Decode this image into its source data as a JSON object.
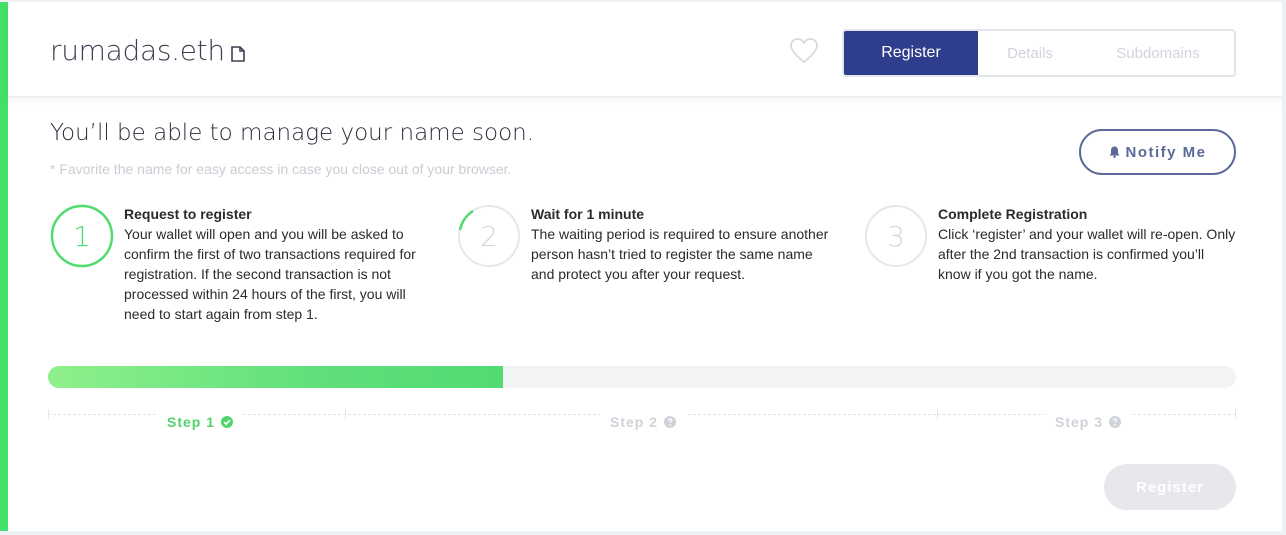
{
  "header": {
    "domain_name": "rumadas.eth",
    "tabs": [
      {
        "label": "Register",
        "active": true
      },
      {
        "label": "Details",
        "active": false
      },
      {
        "label": "Subdomains",
        "active": false
      }
    ]
  },
  "main": {
    "title": "You’ll be able to manage your name soon.",
    "subtitle": "* Favorite the name for easy access in case you close out of your browser.",
    "notify_label": "Notify Me",
    "steps": [
      {
        "number": "1",
        "title": "Request to register",
        "description": "Your wallet will open and you will be asked to confirm the first of two transactions required for registration. If the second transaction is not processed within 24 hours of the first, you will need to start again from step 1."
      },
      {
        "number": "2",
        "title": "Wait for 1 minute",
        "description": "The waiting period is required to ensure another person hasn’t tried to register the same name and protect you after your request."
      },
      {
        "number": "3",
        "title": "Complete Registration",
        "description": "Click ‘register’ and your wallet will re-open. Only after the 2nd transaction is confirmed you’ll know if you got the name."
      }
    ],
    "progress_fraction": 0.383,
    "step_labels": [
      {
        "label": "Step 1",
        "status": "done"
      },
      {
        "label": "Step 2",
        "status": "pending"
      },
      {
        "label": "Step 3",
        "status": "pending"
      }
    ],
    "register_button_label": "Register"
  },
  "colors": {
    "accent_green": "#42e068",
    "primary_navy": "#2f3e8c",
    "notify_blue": "#5b6a98",
    "disabled_grey": "#e6e8ec"
  },
  "icons": [
    "document-icon",
    "heart-icon",
    "bell-icon",
    "check-circle-icon",
    "help-circle-icon"
  ]
}
